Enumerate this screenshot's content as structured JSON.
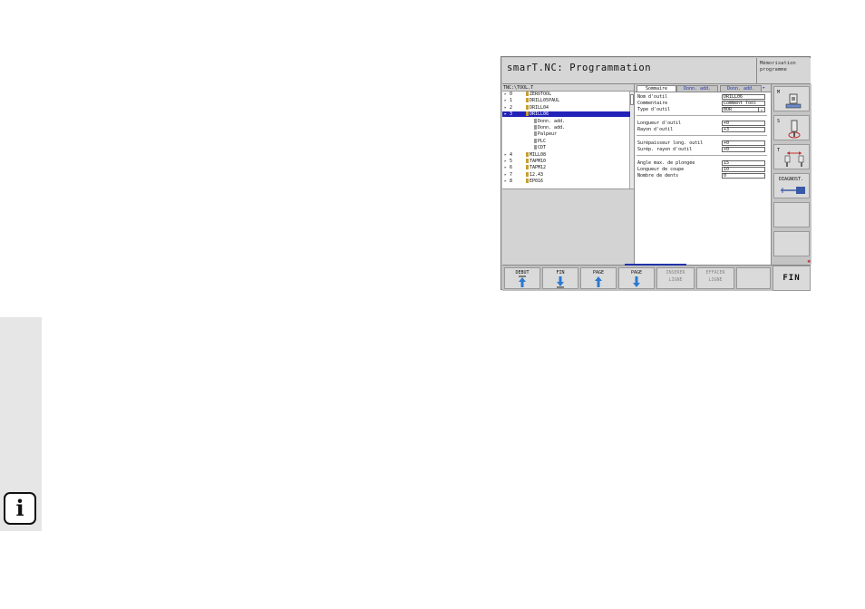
{
  "sidebar": {
    "info_label": "i"
  },
  "screen": {
    "title": "smarT.NC: Programmation",
    "mode": "Mémorisation programme",
    "tree": {
      "path": "TNC:\\TOOL.T",
      "rows": [
        {
          "num": "0",
          "label": "ZEROTOOL",
          "selected": false,
          "child": false
        },
        {
          "num": "1",
          "label": "DRILL05PAUL",
          "selected": false,
          "child": false
        },
        {
          "num": "2",
          "label": "DRILL04",
          "selected": false,
          "child": false
        },
        {
          "num": "3",
          "label": "DRILL06",
          "selected": true,
          "child": false
        },
        {
          "num": "",
          "label": "Donn. add.",
          "selected": false,
          "child": true
        },
        {
          "num": "",
          "label": "Donn. add.",
          "selected": false,
          "child": true
        },
        {
          "num": "",
          "label": "Palpeur",
          "selected": false,
          "child": true
        },
        {
          "num": "",
          "label": "PLC",
          "selected": false,
          "child": true
        },
        {
          "num": "",
          "label": "CDT",
          "selected": false,
          "child": true
        },
        {
          "num": "4",
          "label": "MILL08",
          "selected": false,
          "child": false
        },
        {
          "num": "5",
          "label": "TAPM10",
          "selected": false,
          "child": false
        },
        {
          "num": "6",
          "label": "TAPM12",
          "selected": false,
          "child": false
        },
        {
          "num": "7",
          "label": "12.43",
          "selected": false,
          "child": false
        },
        {
          "num": "8",
          "label": "EP016",
          "selected": false,
          "child": false
        }
      ]
    },
    "form": {
      "tabs": [
        "Sommaire",
        "Donn. add.",
        "Donn. add."
      ],
      "fields": [
        {
          "label": "Nom d'outil",
          "value": "DRILL06"
        },
        {
          "label": "Commentaire",
          "value": "Comment Tool"
        },
        {
          "label": "Type d'outil",
          "value": "BOR"
        },
        {
          "label": "Longueur d'outil",
          "value": "+0"
        },
        {
          "label": "Rayon d'outil",
          "value": "+3"
        },
        {
          "label": "Surépaisseur long. outil",
          "value": "+0"
        },
        {
          "label": "Surép. rayon d'outil",
          "value": "+0"
        },
        {
          "label": "Angle max. de plongée",
          "value": "15"
        },
        {
          "label": "Longueur de coupe",
          "value": "10"
        },
        {
          "label": "Nombre de dents",
          "value": "0"
        }
      ]
    },
    "right_softkeys": [
      {
        "label": "M"
      },
      {
        "label": "S"
      },
      {
        "label": "T"
      },
      {
        "label": "DIAGNOST."
      },
      {
        "label": ""
      },
      {
        "label": ""
      }
    ],
    "bottom_softkeys": [
      {
        "label": "DEBUT",
        "sub": ""
      },
      {
        "label": "FIN",
        "sub": ""
      },
      {
        "label": "PAGE",
        "sub": ""
      },
      {
        "label": "PAGE",
        "sub": ""
      },
      {
        "label": "INSERER",
        "sub": "LIGNE"
      },
      {
        "label": "EFFACER",
        "sub": "LIGNE"
      },
      {
        "label": "",
        "sub": ""
      }
    ],
    "fin_label": "FIN"
  }
}
